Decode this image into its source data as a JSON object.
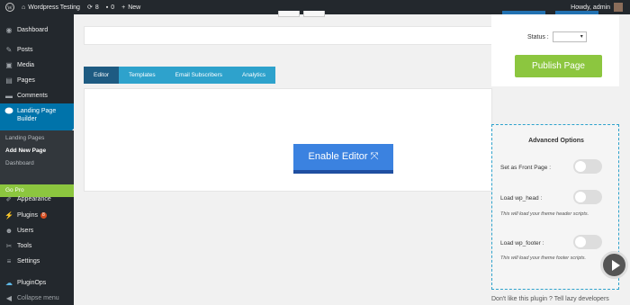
{
  "admin_bar": {
    "site_name": "Wordpress Testing",
    "updates_count": "8",
    "comments_count": "0",
    "new_label": "New",
    "howdy": "Howdy, admin"
  },
  "sidebar": {
    "items": [
      {
        "icon": "dashboard-icon",
        "glyph": "◉",
        "label": "Dashboard"
      },
      {
        "icon": "pin-icon",
        "glyph": "✎",
        "label": "Posts"
      },
      {
        "icon": "media-icon",
        "glyph": "▣",
        "label": "Media"
      },
      {
        "icon": "page-icon",
        "glyph": "▤",
        "label": "Pages"
      },
      {
        "icon": "comment-icon",
        "glyph": "▬",
        "label": "Comments"
      }
    ],
    "active": {
      "label": "Landing Page Builder"
    },
    "submenu": [
      "Landing Pages",
      "Add New Page",
      "Dashboard"
    ],
    "go_pro": "Go Pro",
    "lower": [
      {
        "icon": "brush-icon",
        "glyph": "✐",
        "label": "Appearance"
      },
      {
        "icon": "plug-icon",
        "glyph": "⚡",
        "label": "Plugins",
        "badge": "8"
      },
      {
        "icon": "users-icon",
        "glyph": "☻",
        "label": "Users"
      },
      {
        "icon": "wrench-icon",
        "glyph": "✂",
        "label": "Tools"
      },
      {
        "icon": "sliders-icon",
        "glyph": "≡",
        "label": "Settings"
      },
      {
        "icon": "cloud-icon",
        "glyph": "☁",
        "label": "PluginOps"
      },
      {
        "icon": "collapse-icon",
        "glyph": "◀",
        "label": "Collapse menu"
      }
    ]
  },
  "tabs": [
    "Editor",
    "Templates",
    "Email Subscribers",
    "Analytics"
  ],
  "editor": {
    "enable_label": "Enable Editor ⤧"
  },
  "publish": {
    "status_label": "Status :",
    "status_value": "▾",
    "button": "Publish Page"
  },
  "advanced": {
    "title": "Advanced Options",
    "options": [
      {
        "label": "Set as Front Page :",
        "hint": ""
      },
      {
        "label": "Load wp_head :",
        "hint": "This will load your theme header scripts."
      },
      {
        "label": "Load wp_footer :",
        "hint": "This will load your theme footer scripts."
      }
    ]
  },
  "footer_note": "Don't like this plugin ? Tell lazy developers"
}
